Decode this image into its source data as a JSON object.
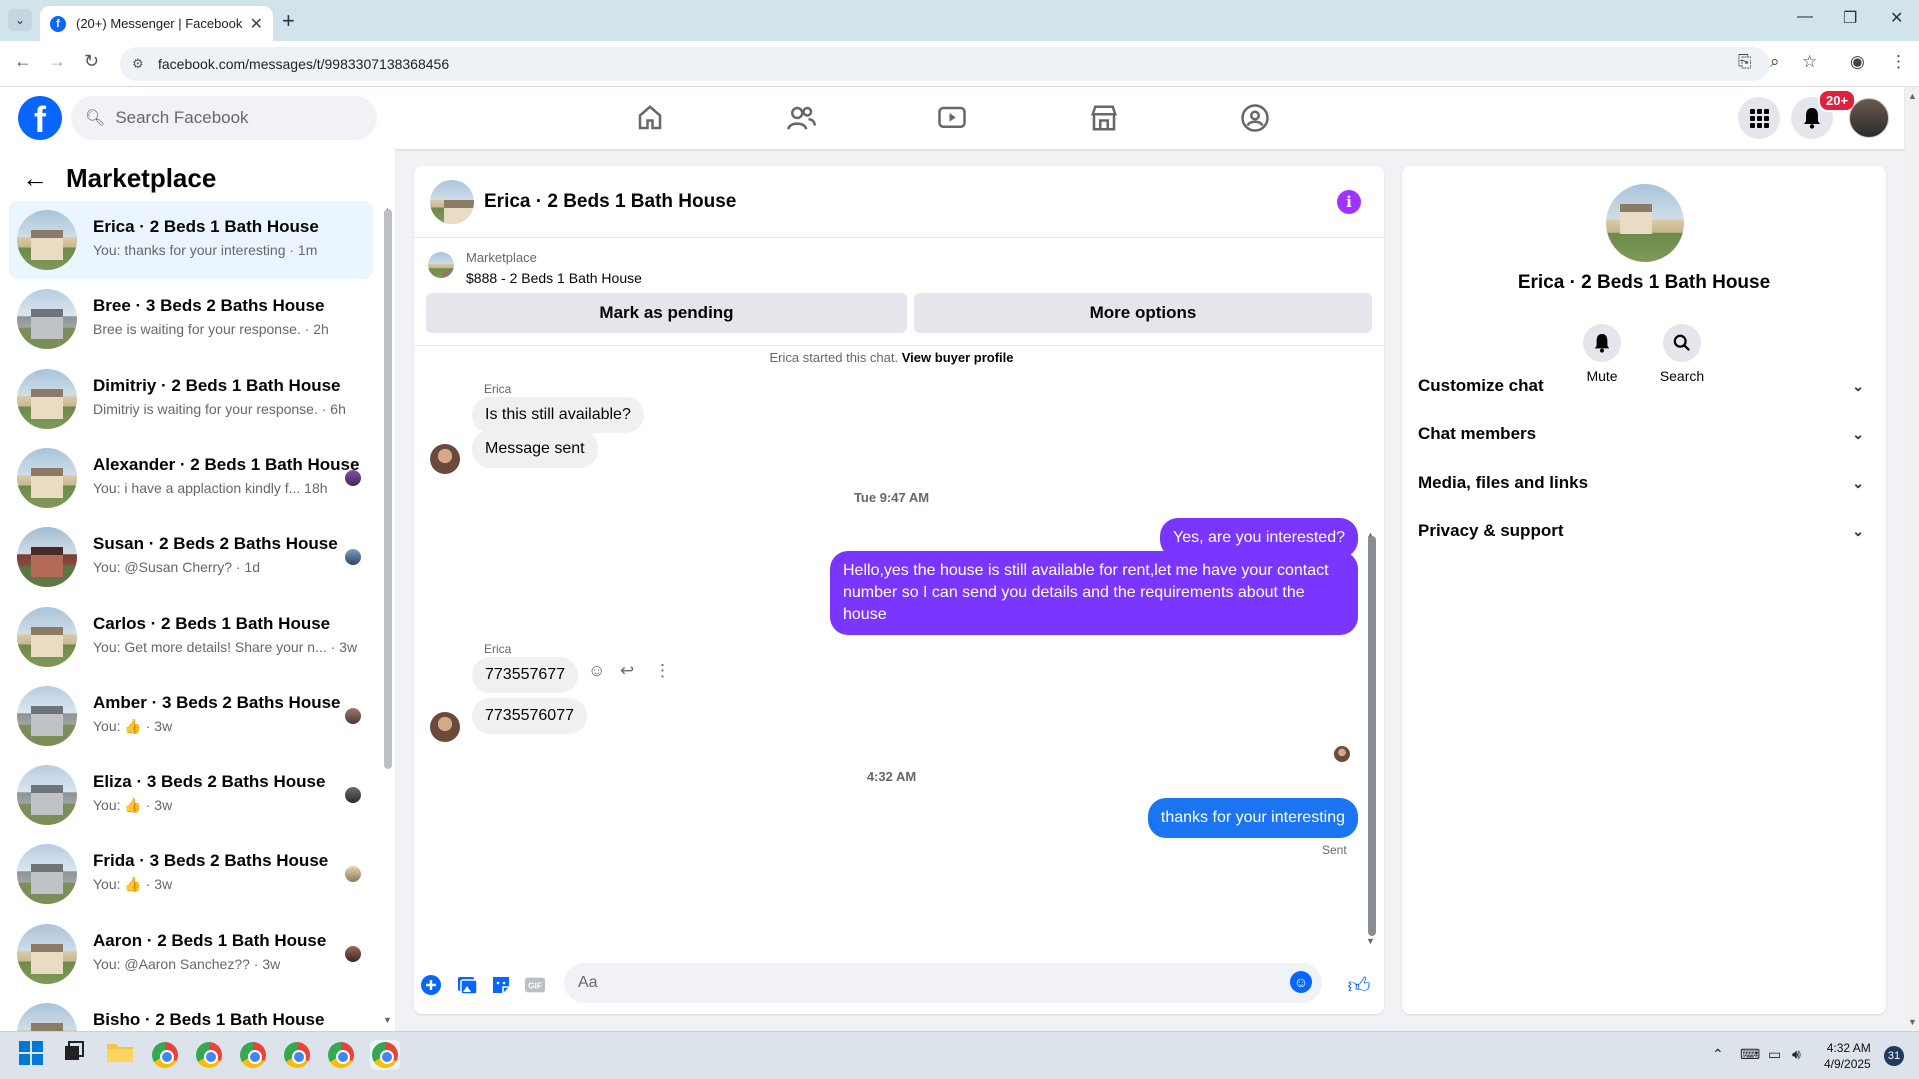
{
  "browser": {
    "tab_title": "(20+) Messenger | Facebook",
    "url": "facebook.com/messages/t/9983307138368456"
  },
  "fb": {
    "logo": "f",
    "search_placeholder": "Search Facebook",
    "notif_badge": "20+",
    "nav_icons": [
      "home-icon",
      "friends-icon",
      "video-icon",
      "marketplace-icon",
      "groups-icon"
    ]
  },
  "sidebar": {
    "title": "Marketplace",
    "conversations": [
      {
        "name": "Erica · 2 Beds 1 Bath House",
        "preview": "You: thanks for your interesting · 1m",
        "active": true
      },
      {
        "name": "Bree · 3 Beds 2 Baths House",
        "preview": "Bree is waiting for your response. · 2h"
      },
      {
        "name": "Dimitriy · 2 Beds 1 Bath House",
        "preview": "Dimitriy is waiting for your response. · 6h"
      },
      {
        "name": "Alexander · 2 Beds 1 Bath House",
        "preview": "You: i have a applaction kindly f...  18h"
      },
      {
        "name": "Susan · 2 Beds 2 Baths House",
        "preview": "You: @Susan Cherry? · 1d"
      },
      {
        "name": "Carlos · 2 Beds 1 Bath House",
        "preview": "You: Get more details! Share your n... · 3w"
      },
      {
        "name": "Amber · 3 Beds 2 Baths House",
        "preview": "You: 👍 · 3w"
      },
      {
        "name": "Eliza · 3 Beds 2 Baths House",
        "preview": "You: 👍 · 3w"
      },
      {
        "name": "Frida · 3 Beds 2 Baths House",
        "preview": "You: 👍 · 3w"
      },
      {
        "name": "Aaron · 2 Beds 1 Bath House",
        "preview": "You: @Aaron Sanchez?? · 3w"
      },
      {
        "name": "Bisho · 2 Beds 1 Bath House",
        "preview": ""
      }
    ]
  },
  "chat": {
    "title": "Erica · 2 Beds 1 Bath House",
    "listing_source": "Marketplace",
    "listing_title": "$888 - 2 Beds 1 Bath House",
    "mark_pending": "Mark as pending",
    "more_options": "More options",
    "started_prefix": "Erica started this chat.",
    "view_profile": "View buyer profile",
    "sender_name": "Erica",
    "msg1": "Is this still available?",
    "msg2": "Message sent",
    "time1": "Tue 9:47 AM",
    "out1": "Yes, are you interested?",
    "out2": "Hello,yes the house is still available for rent,let me have your contact number   so I can send you details and the requirements about the house",
    "sender_name2": "Erica",
    "msg3": "773557677",
    "msg4": "7735576077",
    "time2": "4:32 AM",
    "out3": "thanks for your interesting",
    "sent": "Sent",
    "composer_placeholder": "Aa"
  },
  "details": {
    "name": "Erica · 2 Beds 1 Bath House",
    "mute": "Mute",
    "search": "Search",
    "sections": [
      "Customize chat",
      "Chat members",
      "Media, files and links",
      "Privacy & support"
    ]
  },
  "taskbar": {
    "time": "4:32 AM",
    "date": "4/9/2025",
    "notifications": "31"
  }
}
